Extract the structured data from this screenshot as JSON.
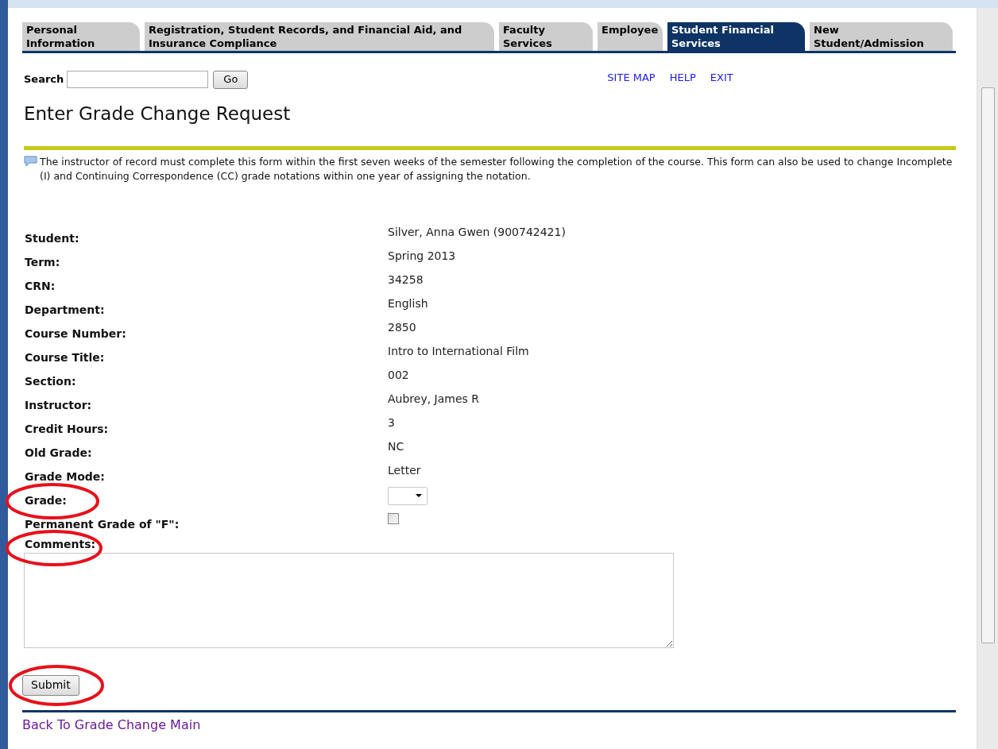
{
  "tabs": [
    {
      "label": "Personal Information",
      "selected": false
    },
    {
      "label": "Registration, Student Records, and Financial Aid, and Insurance Compliance",
      "selected": false
    },
    {
      "label": "Faculty Services",
      "selected": false
    },
    {
      "label": "Employee",
      "selected": false
    },
    {
      "label": "Student Financial Services",
      "selected": true
    },
    {
      "label": "New Student/Admission",
      "selected": false
    }
  ],
  "search": {
    "label": "Search",
    "button": "Go"
  },
  "top_links": [
    "SITE MAP",
    "HELP",
    "EXIT"
  ],
  "title": "Enter Grade Change Request",
  "info_text": "The instructor of record must complete this form within the first seven weeks of the semester following the completion of the course. This form can also be used to change Incomplete (I) and Continuing Correspondence (CC) grade notations within one year of assigning the notation.",
  "fields": [
    {
      "kind": "text",
      "label": "Student:",
      "value": "Silver, Anna Gwen (900742421)",
      "circled": false
    },
    {
      "kind": "text",
      "label": "Term:",
      "value": "Spring 2013",
      "circled": false
    },
    {
      "kind": "text",
      "label": "CRN:",
      "value": "34258",
      "circled": false
    },
    {
      "kind": "text",
      "label": "Department:",
      "value": "English",
      "circled": false
    },
    {
      "kind": "text",
      "label": "Course Number:",
      "value": "2850",
      "circled": false
    },
    {
      "kind": "text",
      "label": "Course Title:",
      "value": "Intro to International Film",
      "circled": false
    },
    {
      "kind": "text",
      "label": "Section:",
      "value": "002",
      "circled": false
    },
    {
      "kind": "text",
      "label": "Instructor:",
      "value": "Aubrey, James R",
      "circled": false
    },
    {
      "kind": "text",
      "label": "Credit Hours:",
      "value": "3",
      "circled": false
    },
    {
      "kind": "text",
      "label": "Old Grade:",
      "value": "NC",
      "circled": false
    },
    {
      "kind": "text",
      "label": "Grade Mode:",
      "value": "Letter",
      "circled": false
    },
    {
      "kind": "select",
      "label": "Grade:",
      "circled": true
    },
    {
      "kind": "checkbox",
      "label": "Permanent Grade of \"F\":",
      "checked": false,
      "circled": false
    }
  ],
  "comments": {
    "label": "Comments:",
    "circled": true
  },
  "submit": {
    "label": "Submit",
    "circled": true
  },
  "back_link": "Back To Grade Change Main"
}
